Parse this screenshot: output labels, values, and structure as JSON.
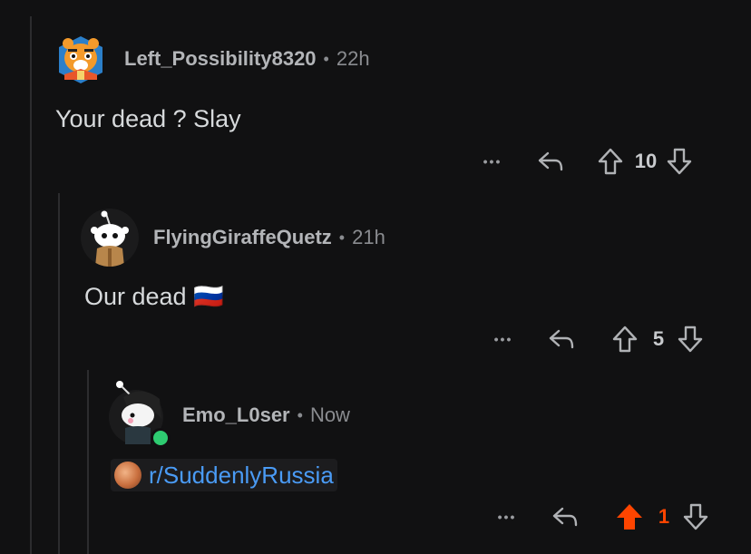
{
  "comments": [
    {
      "username": "Left_Possibility8320",
      "time": "22h",
      "body": "Your dead ? Slay",
      "votes": "10",
      "upvoted": false
    },
    {
      "username": "FlyingGiraffeQuetz",
      "time": "21h",
      "body": "Our dead 🇷🇺",
      "votes": "5",
      "upvoted": false
    },
    {
      "username": "Emo_L0ser",
      "time": "Now",
      "subreddit_link": "r/SuddenlyRussia",
      "votes": "1",
      "upvoted": true,
      "online": true
    }
  ],
  "separator": "•",
  "more_label": "•••",
  "colors": {
    "background": "#111112",
    "upvote_active": "#ff4500",
    "link": "#4a9bf5",
    "online": "#2ecc71"
  }
}
